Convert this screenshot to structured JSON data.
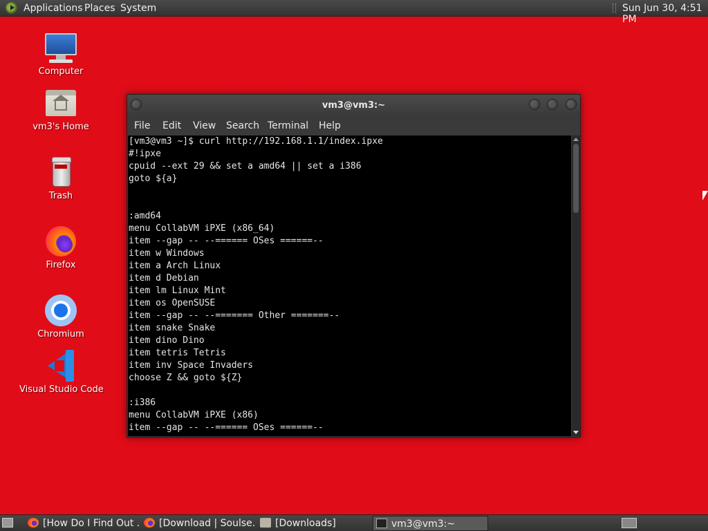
{
  "top_panel": {
    "menus": [
      "Applications",
      "Places",
      "System"
    ],
    "clock": "Sun Jun 30,  4:51 PM"
  },
  "desktop": {
    "icons": [
      {
        "label": "Computer",
        "icon": "computer-icon"
      },
      {
        "label": "vm3's Home",
        "icon": "home-folder-icon"
      },
      {
        "label": "Trash",
        "icon": "trash-icon"
      },
      {
        "label": "Firefox",
        "icon": "firefox-icon"
      },
      {
        "label": "Chromium",
        "icon": "chromium-icon"
      },
      {
        "label": "Visual Studio Code",
        "icon": "vscode-icon"
      }
    ],
    "background_color": "#e00c18"
  },
  "terminal": {
    "title": "vm3@vm3:~",
    "menu": [
      "File",
      "Edit",
      "View",
      "Search",
      "Terminal",
      "Help"
    ],
    "lines": [
      "[vm3@vm3 ~]$ curl http://192.168.1.1/index.ipxe",
      "#!ipxe",
      "cpuid --ext 29 && set a amd64 || set a i386",
      "goto ${a}",
      "",
      "",
      ":amd64",
      "menu CollabVM iPXE (x86_64)",
      "item --gap -- --====== OSes ======--",
      "item w Windows",
      "item a Arch Linux",
      "item d Debian",
      "item lm Linux Mint",
      "item os OpenSUSE",
      "item --gap -- --======= Other =======--",
      "item snake Snake",
      "item dino Dino",
      "item tetris Tetris",
      "item inv Space Invaders",
      "choose Z && goto ${Z}",
      "",
      ":i386",
      "menu CollabVM iPXE (x86)",
      "item --gap -- --====== OSes ======--"
    ]
  },
  "taskbar": {
    "tasks": [
      {
        "label": "[How Do I Find Out ...",
        "icon": "firefox-icon",
        "active": false
      },
      {
        "label": "[Download | Soulse...",
        "icon": "firefox-icon",
        "active": false
      },
      {
        "label": "[Downloads]",
        "icon": "folder-icon",
        "active": false
      },
      {
        "label": "vm3@vm3:~",
        "icon": "terminal-icon",
        "active": true
      }
    ]
  }
}
